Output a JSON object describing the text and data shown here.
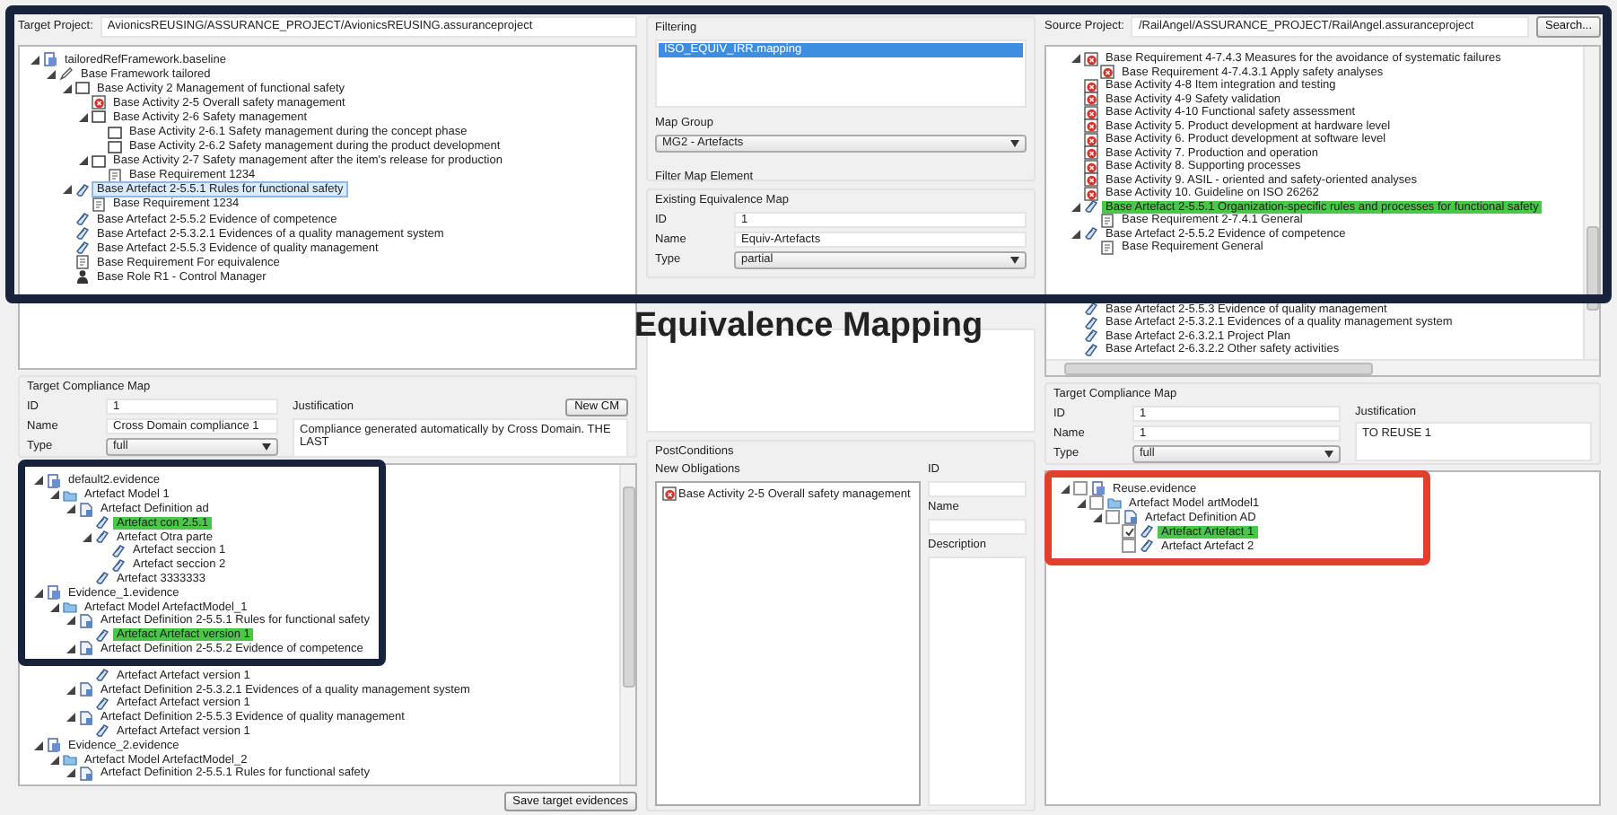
{
  "title": "Equivalence Mapping",
  "target": {
    "project_label": "Target Project:",
    "project_path": "AvionicsREUSING/ASSURANCE_PROJECT/AvionicsREUSING.assuranceproject",
    "tree": [
      {
        "label": "tailoredRefFramework.baseline",
        "kind": "baseline",
        "expanded": true,
        "selected": false,
        "highlighted": false,
        "children": [
          {
            "label": "Base Framework tailored",
            "kind": "framework",
            "expanded": true,
            "selected": false,
            "highlighted": false,
            "children": [
              {
                "label": "Base Activity 2 Management of functional safety",
                "kind": "activity",
                "expanded": true,
                "selected": false,
                "highlighted": false,
                "children": [
                  {
                    "label": "Base Activity 2-5 Overall safety management",
                    "kind": "activity-error",
                    "selected": false,
                    "highlighted": false
                  },
                  {
                    "label": "Base Activity 2-6 Safety management",
                    "kind": "activity",
                    "expanded": true,
                    "selected": false,
                    "highlighted": false,
                    "children": [
                      {
                        "label": "Base Activity 2-6.1 Safety management during the concept phase",
                        "kind": "activity",
                        "selected": false,
                        "highlighted": false
                      },
                      {
                        "label": "Base Activity 2-6.2 Safety management during the product development",
                        "kind": "activity",
                        "selected": false,
                        "highlighted": false
                      }
                    ]
                  },
                  {
                    "label": "Base Activity 2-7 Safety management after the item's release for production",
                    "kind": "activity",
                    "expanded": true,
                    "selected": false,
                    "highlighted": false,
                    "children": [
                      {
                        "label": "Base Requirement 1234",
                        "kind": "requirement",
                        "selected": false,
                        "highlighted": false
                      }
                    ]
                  }
                ]
              },
              {
                "label": "Base Artefact 2-5.5.1 Rules for functional safety",
                "kind": "artefact",
                "expanded": true,
                "selected": true,
                "highlighted": false,
                "children": [
                  {
                    "label": "Base Requirement 1234",
                    "kind": "requirement",
                    "selected": false,
                    "highlighted": false
                  }
                ]
              },
              {
                "label": "Base Artefact 2-5.5.2 Evidence of competence",
                "kind": "artefact",
                "selected": false,
                "highlighted": false
              },
              {
                "label": "Base Artefact 2-5.3.2.1 Evidences of a quality management system",
                "kind": "artefact",
                "selected": false,
                "highlighted": false
              },
              {
                "label": "Base Artefact 2-5.5.3 Evidence of quality management",
                "kind": "artefact",
                "selected": false,
                "highlighted": false
              },
              {
                "label": "Base Requirement For equivalence",
                "kind": "requirement",
                "selected": false,
                "highlighted": false
              },
              {
                "label": "Base Role R1 - Control Manager",
                "kind": "role",
                "selected": false,
                "highlighted": false
              }
            ]
          }
        ]
      }
    ],
    "compliance": {
      "heading": "Target Compliance Map",
      "id_label": "ID",
      "id": "1",
      "name_label": "Name",
      "name": "Cross Domain compliance 1",
      "type_label": "Type",
      "type": "full",
      "justification_label": "Justification",
      "justification": "Compliance generated automatically by Cross Domain. THE LAST",
      "button": "New CM"
    },
    "evidence": [
      {
        "label": "default2.evidence",
        "kind": "evidence",
        "expanded": true,
        "selected": false,
        "highlighted": false,
        "children": [
          {
            "label": "Artefact Model 1",
            "kind": "model",
            "expanded": true,
            "selected": false,
            "highlighted": false,
            "children": [
              {
                "label": "Artefact Definition ad",
                "kind": "definition",
                "expanded": true,
                "selected": false,
                "highlighted": false,
                "children": [
                  {
                    "label": "Artefact con 2.5.1",
                    "kind": "artefact",
                    "selected": false,
                    "highlighted": true
                  },
                  {
                    "label": "Artefact Otra parte",
                    "kind": "artefact",
                    "expanded": true,
                    "selected": false,
                    "highlighted": false,
                    "children": [
                      {
                        "label": "Artefact seccion 1",
                        "kind": "artefact",
                        "selected": false,
                        "highlighted": false
                      },
                      {
                        "label": "Artefact seccion 2",
                        "kind": "artefact",
                        "selected": false,
                        "highlighted": false
                      }
                    ]
                  },
                  {
                    "label": "Artefact 3333333",
                    "kind": "artefact",
                    "selected": false,
                    "highlighted": false
                  }
                ]
              }
            ]
          }
        ]
      },
      {
        "label": "Evidence_1.evidence",
        "kind": "evidence",
        "expanded": true,
        "selected": false,
        "highlighted": false,
        "children": [
          {
            "label": "Artefact Model ArtefactModel_1",
            "kind": "model",
            "expanded": true,
            "selected": false,
            "highlighted": false,
            "children": [
              {
                "label": "Artefact Definition 2-5.5.1 Rules for functional safety",
                "kind": "definition",
                "expanded": true,
                "selected": false,
                "highlighted": false,
                "children": [
                  {
                    "label": "Artefact Artefact version 1",
                    "kind": "artefact",
                    "selected": false,
                    "highlighted": true
                  }
                ]
              },
              {
                "label": "Artefact Definition 2-5.5.2 Evidence of competence",
                "kind": "definition",
                "expanded": true,
                "selected": false,
                "highlighted": false,
                "children": [
                  {
                    "label": "Artefact Artefact version 1",
                    "kind": "artefact",
                    "selected": false,
                    "highlighted": false
                  }
                ]
              },
              {
                "label": "Artefact Definition 2-5.3.2.1 Evidences of a quality management system",
                "kind": "definition",
                "expanded": true,
                "selected": false,
                "highlighted": false,
                "children": [
                  {
                    "label": "Artefact Artefact version 1",
                    "kind": "artefact",
                    "selected": false,
                    "highlighted": false
                  }
                ]
              },
              {
                "label": "Artefact Definition 2-5.5.3 Evidence of quality management",
                "kind": "definition",
                "expanded": true,
                "selected": false,
                "highlighted": false,
                "children": [
                  {
                    "label": "Artefact Artefact version 1",
                    "kind": "artefact",
                    "selected": false,
                    "highlighted": false
                  }
                ]
              }
            ]
          }
        ]
      },
      {
        "label": "Evidence_2.evidence",
        "kind": "evidence",
        "expanded": true,
        "selected": false,
        "highlighted": false,
        "children": [
          {
            "label": "Artefact Model ArtefactModel_2",
            "kind": "model",
            "expanded": true,
            "selected": false,
            "highlighted": false,
            "children": [
              {
                "label": "Artefact Definition 2-5.5.1 Rules for functional safety",
                "kind": "definition",
                "expanded": true,
                "selected": false,
                "highlighted": false
              }
            ]
          }
        ]
      }
    ],
    "save_button": "Save target evidences"
  },
  "middle": {
    "filtering_label": "Filtering",
    "mappings": [
      {
        "label": "ISO_EQUIV_IRR.mapping",
        "selected": true
      }
    ],
    "map_group_label": "Map Group",
    "map_group": "MG2 - Artefacts",
    "filter_label": "Filter Map Element",
    "existing": {
      "heading": "Existing Equivalence Map",
      "id_label": "ID",
      "id": "1",
      "name_label": "Name",
      "name": "Equiv-Artefacts",
      "type_label": "Type",
      "type": "partial"
    },
    "postconditions": {
      "heading": "PostConditions",
      "obligations_label": "New Obligations",
      "obligations": [
        {
          "label": "Base Activity 2-5 Overall safety management",
          "kind": "activity-error"
        }
      ],
      "id_label": "ID",
      "name_label": "Name",
      "description_label": "Description"
    }
  },
  "source": {
    "project_label": "Source Project:",
    "project_path": "/RailAngel/ASSURANCE_PROJECT/RailAngel.assuranceproject",
    "search_button": "Search...",
    "tree": [
      {
        "label": "Base Requirement 4-7.4.3 Measures for the avoidance of systematic failures",
        "kind": "requirement-error",
        "expanded": true,
        "selected": false,
        "highlighted": false,
        "children": [
          {
            "label": "Base Requirement 4-7.4.3.1 Apply safety analyses",
            "kind": "requirement-error",
            "selected": false,
            "highlighted": false
          }
        ]
      },
      {
        "label": "Base Activity 4-8 Item integration and testing",
        "kind": "activity-error",
        "selected": false,
        "highlighted": false
      },
      {
        "label": "Base Activity 4-9 Safety validation",
        "kind": "activity-error",
        "selected": false,
        "highlighted": false
      },
      {
        "label": "Base Activity 4-10 Functional safety assessment",
        "kind": "activity-error",
        "selected": false,
        "highlighted": false
      },
      {
        "label": "Base Activity 5. Product development at hardware level",
        "kind": "activity-error",
        "selected": false,
        "highlighted": false
      },
      {
        "label": "Base Activity 6. Product development at software level",
        "kind": "activity-error",
        "selected": false,
        "highlighted": false
      },
      {
        "label": "Base Activity 7. Production and operation",
        "kind": "activity-error",
        "selected": false,
        "highlighted": false
      },
      {
        "label": "Base Activity 8. Supporting processes",
        "kind": "activity-error",
        "selected": false,
        "highlighted": false
      },
      {
        "label": "Base Activity 9. ASIL - oriented and safety-oriented analyses",
        "kind": "activity-error",
        "selected": false,
        "highlighted": false
      },
      {
        "label": "Base Activity 10. Guideline on ISO 26262",
        "kind": "activity-error",
        "selected": false,
        "highlighted": false
      },
      {
        "label": "Base Artefact 2-5.5.1 Organization-specific rules and processes for functional safety",
        "kind": "artefact",
        "expanded": true,
        "selected": false,
        "highlighted": true,
        "children": [
          {
            "label": "Base Requirement 2-7.4.1 General",
            "kind": "requirement",
            "selected": false,
            "highlighted": false
          }
        ]
      },
      {
        "label": "Base Artefact 2-5.5.2 Evidence of competence",
        "kind": "artefact",
        "expanded": true,
        "selected": false,
        "highlighted": false,
        "children": [
          {
            "label": "Base Requirement General",
            "kind": "requirement",
            "selected": false,
            "highlighted": false
          }
        ]
      },
      {
        "label": "Base Artefact 2-5.5.3 Evidence of quality management",
        "kind": "artefact",
        "selected": false,
        "highlighted": false
      },
      {
        "label": "Base Artefact 2-5.3.2.1 Evidences of a quality management system",
        "kind": "artefact",
        "selected": false,
        "highlighted": false
      },
      {
        "label": "Base Artefact 2-6.3.2.1 Project Plan",
        "kind": "artefact",
        "selected": false,
        "highlighted": false
      },
      {
        "label": "Base Artefact 2-6.3.2.2 Other safety activities",
        "kind": "artefact",
        "selected": false,
        "highlighted": false
      }
    ],
    "compliance": {
      "heading": "Target Compliance Map",
      "id_label": "ID",
      "id": "1",
      "name_label": "Name",
      "name": "1",
      "type_label": "Type",
      "type": "full",
      "justification_label": "Justification",
      "justification": "TO REUSE 1"
    },
    "evidence": [
      {
        "label": "Reuse.evidence",
        "kind": "evidence",
        "expanded": true,
        "checked": false,
        "highlighted": false,
        "children": [
          {
            "label": "Artefact Model artModel1",
            "kind": "model",
            "expanded": true,
            "checked": false,
            "highlighted": false,
            "children": [
              {
                "label": "Artefact Definition AD",
                "kind": "definition",
                "expanded": true,
                "checked": false,
                "highlighted": false,
                "children": [
                  {
                    "label": "Artefact Artefact 1",
                    "kind": "artefact",
                    "checked": true,
                    "highlighted": true
                  },
                  {
                    "label": "Artefact Artefact 2",
                    "kind": "artefact",
                    "checked": false,
                    "highlighted": false
                  }
                ]
              }
            ]
          }
        ]
      }
    ]
  }
}
